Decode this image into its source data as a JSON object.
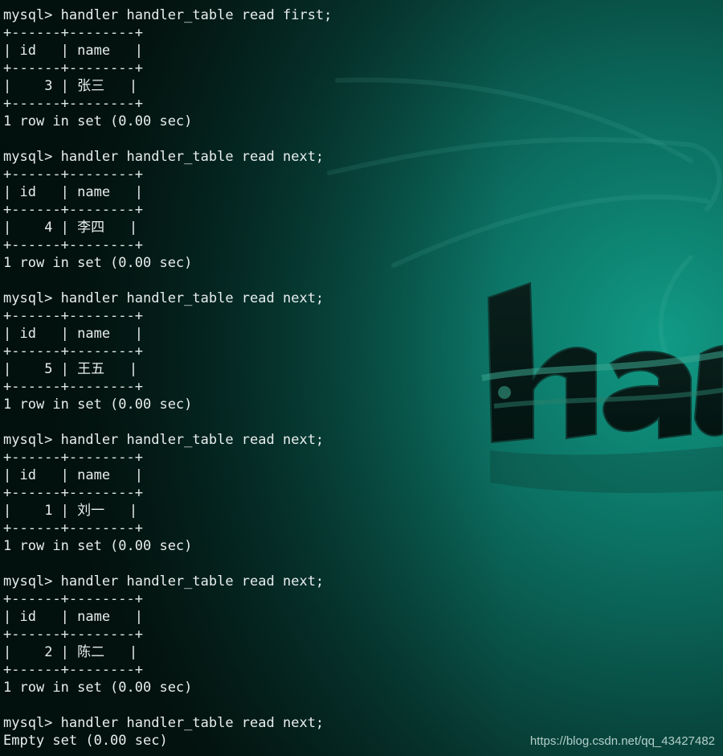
{
  "colors": {
    "background_dark": "#06201c",
    "background_teal": "#0d8a78",
    "text": "#e8eeee"
  },
  "background": {
    "logo_icon": "kali-dragon-logo-icon"
  },
  "terminal": {
    "blocks": [
      {
        "prompt": "mysql> handler handler_table read first;",
        "border": "+------+--------+",
        "header": "| id   | name   |",
        "row": {
          "id": "3",
          "name": "张三"
        },
        "result": "1 row in set (0.00 sec)"
      },
      {
        "prompt": "mysql> handler handler_table read next;",
        "border": "+------+--------+",
        "header": "| id   | name   |",
        "row": {
          "id": "4",
          "name": "李四"
        },
        "result": "1 row in set (0.00 sec)"
      },
      {
        "prompt": "mysql> handler handler_table read next;",
        "border": "+------+--------+",
        "header": "| id   | name   |",
        "row": {
          "id": "5",
          "name": "王五"
        },
        "result": "1 row in set (0.00 sec)"
      },
      {
        "prompt": "mysql> handler handler_table read next;",
        "border": "+------+--------+",
        "header": "| id   | name   |",
        "row": {
          "id": "1",
          "name": "刘一"
        },
        "result": "1 row in set (0.00 sec)"
      },
      {
        "prompt": "mysql> handler handler_table read next;",
        "border": "+------+--------+",
        "header": "| id   | name   |",
        "row": {
          "id": "2",
          "name": "陈二"
        },
        "result": "1 row in set (0.00 sec)"
      }
    ],
    "final": {
      "prompt": "mysql> handler handler_table read next;",
      "result": "Empty set (0.00 sec)"
    }
  },
  "watermark": "https://blog.csdn.net/qq_43427482"
}
